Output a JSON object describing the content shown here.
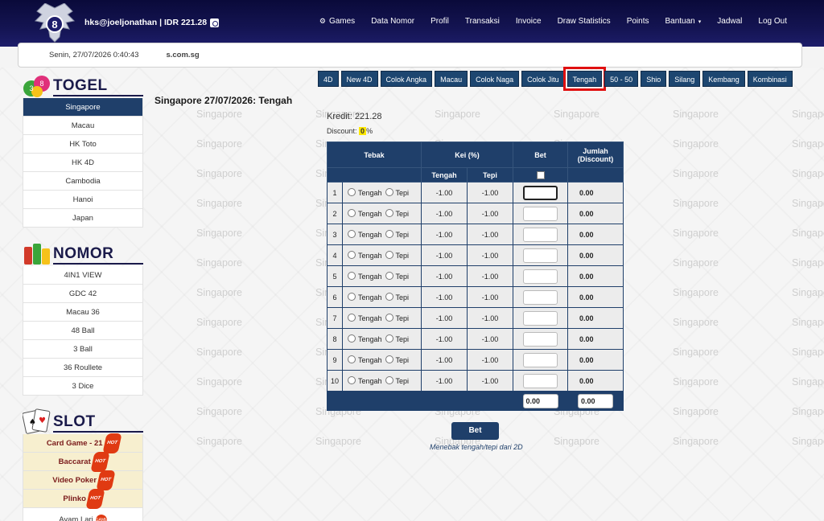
{
  "header": {
    "user": "hks@joeljonathan | IDR 221.28",
    "nav": [
      {
        "label": "Games",
        "icon": "gamepad-icon"
      },
      {
        "label": "Data Nomor"
      },
      {
        "label": "Profil"
      },
      {
        "label": "Transaksi"
      },
      {
        "label": "Invoice"
      },
      {
        "label": "Draw Statistics"
      },
      {
        "label": "Points"
      },
      {
        "label": "Bantuan",
        "caret": "▾"
      },
      {
        "label": "Jadwal"
      },
      {
        "label": "Log Out"
      }
    ]
  },
  "datebar": {
    "datetime": "Senin, 27/07/2026 0:40:43",
    "marquee": "s.com.sg"
  },
  "sidebar": {
    "togel": {
      "title": "TOGEL",
      "items": [
        "Singapore",
        "Macau",
        "HK Toto",
        "HK 4D",
        "Cambodia",
        "Hanoi",
        "Japan"
      ]
    },
    "nomor": {
      "title": "NOMOR",
      "items": [
        "4IN1 VIEW",
        "GDC 42",
        "Macau 36",
        "48 Ball",
        "3 Ball",
        "36 Roullete",
        "3 Dice"
      ]
    },
    "slot": {
      "title": "SLOT",
      "items": [
        "Card Game - 21",
        "Baccarat",
        "Video Poker",
        "Plinko",
        "Ayam Lari"
      ],
      "hot_label": "HOT",
      "game_label": "GAME"
    }
  },
  "tabs": [
    "4D",
    "New 4D",
    "Colok Angka",
    "Macau",
    "Colok Naga",
    "Colok Jitu",
    "Tengah",
    "50 - 50",
    "Shio",
    "Silang",
    "Kembang",
    "Kombinasi"
  ],
  "active_tab": "Tengah",
  "content": {
    "title": "Singapore 27/07/2026: Tengah",
    "kredit": "Kredit: 221.28",
    "discount_label": "Discount:",
    "discount_value": "0",
    "discount_unit": "%",
    "watermark": "Singapore",
    "table": {
      "headers": {
        "tebak": "Tebak",
        "kei": "Kei (%)",
        "bet": "Bet",
        "jumlah": "Jumlah (Discount)"
      },
      "sub": {
        "tengah": "Tengah",
        "tepi": "Tepi"
      },
      "option_tengah": "Tengah",
      "option_tepi": "Tepi",
      "rows": [
        {
          "no": "1",
          "kei_tengah": "-1.00",
          "kei_tepi": "-1.00",
          "jumlah": "0.00"
        },
        {
          "no": "2",
          "kei_tengah": "-1.00",
          "kei_tepi": "-1.00",
          "jumlah": "0.00"
        },
        {
          "no": "3",
          "kei_tengah": "-1.00",
          "kei_tepi": "-1.00",
          "jumlah": "0.00"
        },
        {
          "no": "4",
          "kei_tengah": "-1.00",
          "kei_tepi": "-1.00",
          "jumlah": "0.00"
        },
        {
          "no": "5",
          "kei_tengah": "-1.00",
          "kei_tepi": "-1.00",
          "jumlah": "0.00"
        },
        {
          "no": "6",
          "kei_tengah": "-1.00",
          "kei_tepi": "-1.00",
          "jumlah": "0.00"
        },
        {
          "no": "7",
          "kei_tengah": "-1.00",
          "kei_tepi": "-1.00",
          "jumlah": "0.00"
        },
        {
          "no": "8",
          "kei_tengah": "-1.00",
          "kei_tepi": "-1.00",
          "jumlah": "0.00"
        },
        {
          "no": "9",
          "kei_tengah": "-1.00",
          "kei_tepi": "-1.00",
          "jumlah": "0.00"
        },
        {
          "no": "10",
          "kei_tengah": "-1.00",
          "kei_tepi": "-1.00",
          "jumlah": "0.00"
        }
      ],
      "total_bet": "0.00",
      "total_jumlah": "0.00"
    },
    "bet_button": "Bet",
    "hint": "Menebak tengah/tepi dari 2D"
  }
}
